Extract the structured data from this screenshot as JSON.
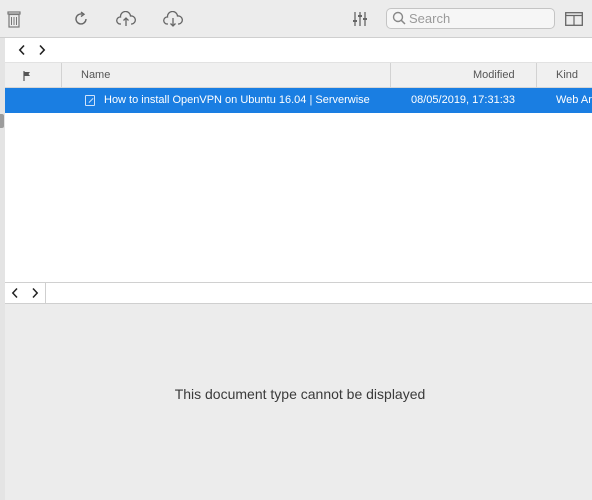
{
  "toolbar": {
    "icons": [
      "trash-icon",
      "refresh-icon",
      "upload-cloud-icon",
      "download-cloud-icon",
      "filter-sliders-icon",
      "sidebar-toggle-icon"
    ],
    "search": {
      "placeholder": "Search",
      "value": "",
      "icon": "search-icon"
    }
  },
  "navigation": {
    "back_icon": "chevron-left-icon",
    "forward_icon": "chevron-right-icon"
  },
  "table": {
    "columns": {
      "flag_icon": "flag-icon",
      "name": "Name",
      "modified": "Modified",
      "kind": "Kind"
    },
    "rows": [
      {
        "name": "How to install OpenVPN on Ubuntu 16.04 | Serverwise",
        "modified": "08/05/2019, 17:31:33",
        "kind": "Web Ar",
        "selected": true,
        "icon": "web-archive-file-icon"
      }
    ]
  },
  "preview": {
    "back_icon": "chevron-left-icon",
    "forward_icon": "chevron-right-icon",
    "message": "This document type cannot be displayed"
  },
  "colors": {
    "selection": "#1a7ee2",
    "toolbar_bg": "#ececec",
    "preview_bg": "#ececec"
  }
}
